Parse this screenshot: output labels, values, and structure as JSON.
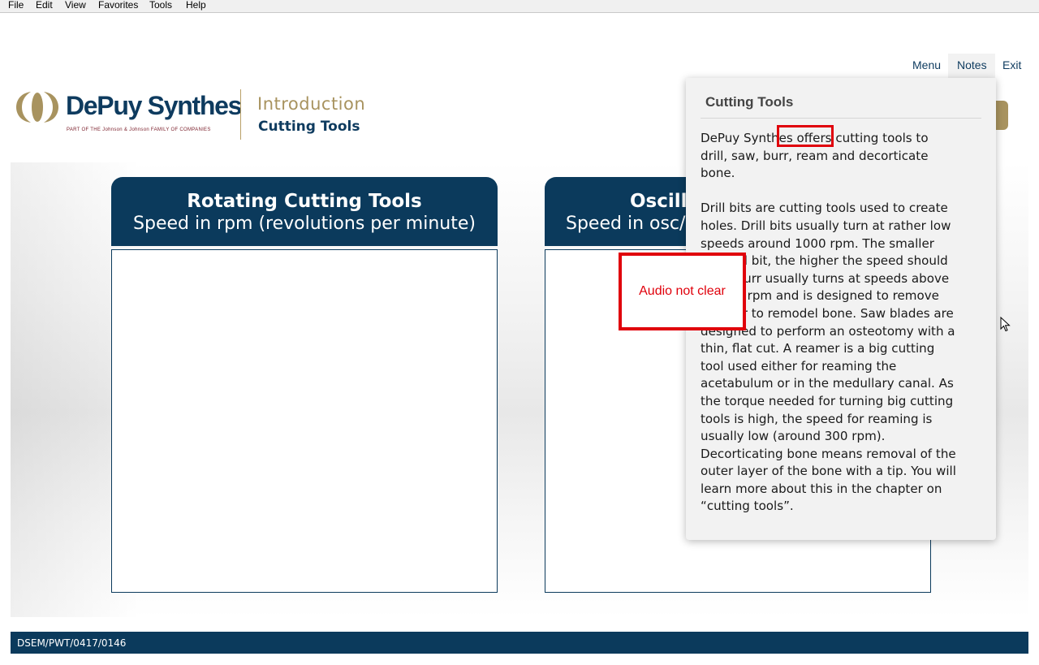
{
  "menu": [
    "File",
    "Edit",
    "View",
    "Favorites",
    "Tools",
    "Help"
  ],
  "nav": {
    "menu": "Menu",
    "notes": "Notes",
    "exit": "Exit"
  },
  "brand": {
    "name": "DePuy Synthes",
    "tagline": "PART OF THE Johnson & Johnson FAMILY OF COMPANIES"
  },
  "header": {
    "section": "Introduction",
    "topic": "Cutting Tools"
  },
  "panels": [
    {
      "title": "Rotating Cutting Tools",
      "subtitle": "Speed in rpm (revolutions per minute)"
    },
    {
      "title": "Oscilla",
      "subtitle": "Speed in osc/r"
    }
  ],
  "notes": {
    "title": "Cutting Tools",
    "paragraph1": "DePuy Synthes offers cutting tools to drill, saw, burr, ream and decorticate bone.",
    "paragraph2": "Drill bits are cutting tools used to create holes. Drill bits usually turn at rather low speeds around 1000 rpm. The smaller the drill bit, the higher the speed should be. A burr usually turns at speeds above 20,000 rpm and is designed to remove bone or to remodel bone. Saw blades are designed to perform an osteotomy with a thin, flat cut. A reamer is a big cutting tool used either for reaming the acetabulum or in the medullary canal. As the torque needed for turning big cutting tools is high, the speed for reaming is usually low (around 300 rpm). Decorticating bone means removal of the outer layer of the bone with a tip. You will learn more about this in the chapter on “cutting tools”."
  },
  "annotation": {
    "comment": "Audio not clear"
  },
  "footer": {
    "code": "DSEM/PWT/0417/0146"
  },
  "colors": {
    "navy": "#0b3a5c",
    "gold": "#a8935f",
    "annotation_red": "#e0000b"
  }
}
